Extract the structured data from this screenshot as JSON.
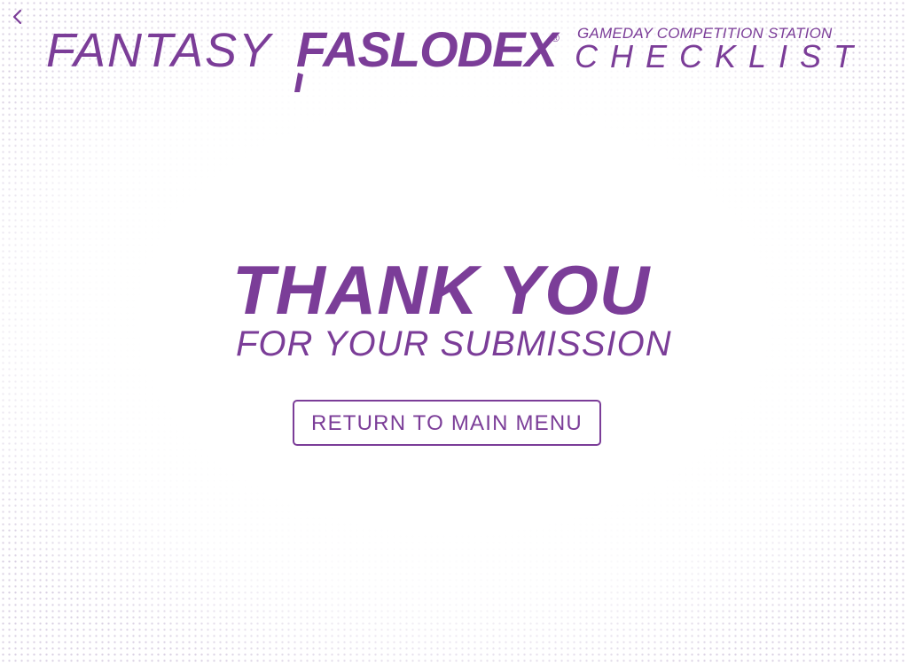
{
  "nav": {
    "back_icon": "chevron-left-icon"
  },
  "header": {
    "brand_prefix": "FANTASY",
    "brand_name": "FASLODEX",
    "registered_mark": "®",
    "station_label": "GAMEDAY COMPETITION STATION",
    "checklist_label": "CHECKLIST"
  },
  "main": {
    "title": "THANK YOU",
    "subtitle": "FOR YOUR SUBMISSION",
    "return_button_label": "RETURN TO MAIN MENU"
  },
  "colors": {
    "brand_purple": "#7b3d98",
    "background": "#ffffff",
    "dot_pattern": "#d9d0e2"
  }
}
